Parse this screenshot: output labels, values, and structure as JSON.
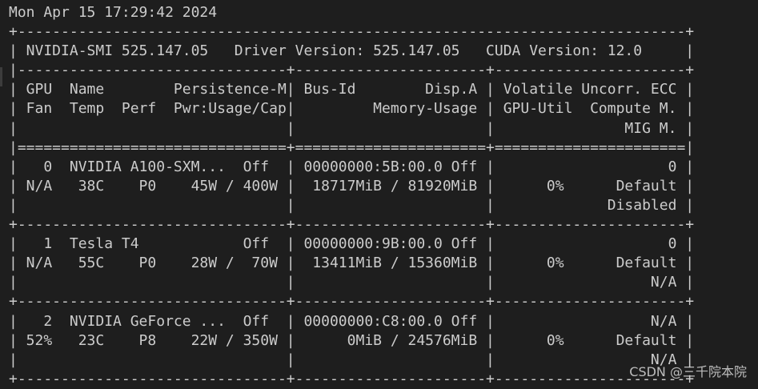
{
  "terminal": {
    "lines": [
      "Mon Apr 15 17:29:42 2024",
      "+-----------------------------------------------------------------------------+",
      "| NVIDIA-SMI 525.147.05   Driver Version: 525.147.05   CUDA Version: 12.0     |",
      "|-------------------------------+----------------------+----------------------+",
      "| GPU  Name        Persistence-M| Bus-Id        Disp.A | Volatile Uncorr. ECC |",
      "| Fan  Temp  Perf  Pwr:Usage/Cap|         Memory-Usage | GPU-Util  Compute M. |",
      "|                               |                      |               MIG M. |",
      "|===============================+======================+======================|",
      "|   0  NVIDIA A100-SXM...  Off  | 00000000:5B:00.0 Off |                    0 |",
      "| N/A   38C    P0    45W / 400W |  18717MiB / 81920MiB |      0%      Default |",
      "|                               |                      |             Disabled |",
      "+-------------------------------+----------------------+----------------------+",
      "|   1  Tesla T4            Off  | 00000000:9B:00.0 Off |                    0 |",
      "| N/A   55C    P0    28W /  70W |  13411MiB / 15360MiB |      0%      Default |",
      "|                               |                      |                  N/A |",
      "+-------------------------------+----------------------+----------------------+",
      "|   2  NVIDIA GeForce ...  Off  | 00000000:C8:00.0 Off |                  N/A |",
      "| 52%   23C    P8    22W / 350W |      0MiB / 24576MiB |      0%      Default |",
      "|                               |                      |                  N/A |",
      "+-------------------------------+----------------------+----------------------+"
    ]
  },
  "watermark": "CSDN @三千院本院",
  "colors": {
    "background": "#1e1e1e",
    "text": "#cccccc"
  }
}
